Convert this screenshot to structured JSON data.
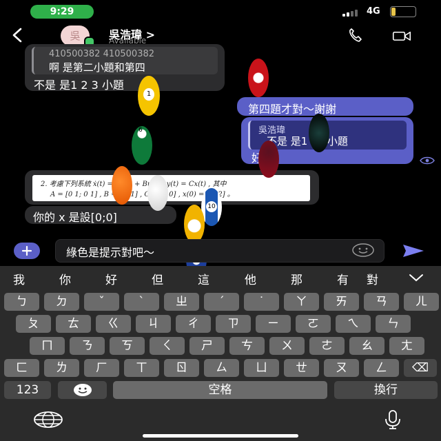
{
  "status": {
    "time": "9:29",
    "network": "4G",
    "battery": "17",
    "battery_level": 0.17
  },
  "header": {
    "avatar_text": "吳",
    "name": "吳浩瑋",
    "chevron": ">",
    "presence": "Available",
    "call_icon": "phone-icon",
    "video_icon": "video-camera-icon"
  },
  "messages": [
    {
      "quote_line": "410500382 410500382",
      "quote_body": "啊 是第二小題和第四",
      "text": "不是 是1 2 3 小題"
    },
    {
      "text": "第四題才對～謝謝"
    },
    {
      "quote_name": "吳浩瑋",
      "quote_body": "不是 是1 2 3小題",
      "text": "好"
    },
    {
      "formula_line1": "2.  考慮下列系統 ẋ(t) = Ax(t) + Bu(t) , y(t) = Cx(t) , 其中",
      "formula_line2": "A = [0 1; 0 1] , B = [0; 1] , C = [1  0] , x(0) = [5; 2] 。"
    },
    {
      "text": "你的 x 是設[0;0]"
    }
  ],
  "compose": {
    "text": "綠色是提示對吧～",
    "emoji_icon": "emoji-icon",
    "send_icon": "send-icon",
    "plus_icon": "plus-icon"
  },
  "keyboard": {
    "candidates": [
      "我",
      "你",
      "好",
      "但",
      "這",
      "他",
      "那",
      "有",
      "對"
    ],
    "row1": [
      "ㄅ",
      "ㄉ",
      "ˇ",
      "ˋ",
      "ㄓ",
      "ˊ",
      "˙",
      "ㄚ",
      "ㄞ",
      "ㄢ",
      "ㄦ"
    ],
    "row2": [
      "ㄆ",
      "ㄊ",
      "ㄍ",
      "ㄐ",
      "ㄔ",
      "ㄗ",
      "ㄧ",
      "ㄛ",
      "ㄟ",
      "ㄣ"
    ],
    "row3": [
      "ㄇ",
      "ㄋ",
      "ㄎ",
      "ㄑ",
      "ㄕ",
      "ㄘ",
      "ㄨ",
      "ㄜ",
      "ㄠ",
      "ㄤ"
    ],
    "row4": [
      "ㄈ",
      "ㄌ",
      "ㄏ",
      "ㄒ",
      "ㄖ",
      "ㄙ",
      "ㄩ",
      "ㄝ",
      "ㄡ",
      "ㄥ"
    ],
    "backspace": "⌫",
    "numbers": "123",
    "space": "空格",
    "return": "換行",
    "globe_icon": "globe-icon",
    "mic_icon": "microphone-icon"
  },
  "overlay": {
    "effect": "billiard-balls",
    "numbers": [
      "1",
      "6",
      "9",
      "10"
    ]
  }
}
